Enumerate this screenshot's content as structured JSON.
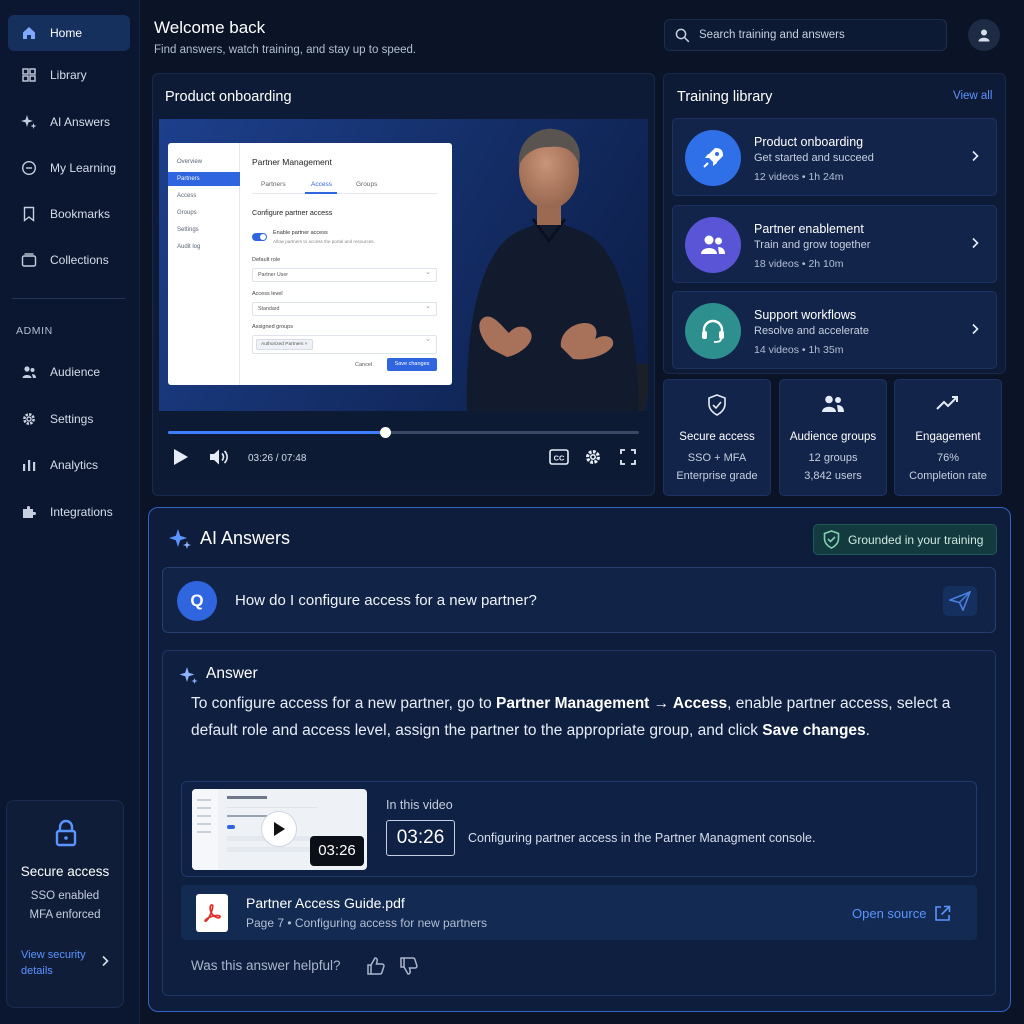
{
  "sidebar": {
    "items": [
      {
        "label": "Home",
        "icon": "home-icon"
      },
      {
        "label": "Library",
        "icon": "library-icon"
      },
      {
        "label": "AI Answers",
        "icon": "sparkle-icon"
      },
      {
        "label": "My Learning",
        "icon": "learning-icon"
      },
      {
        "label": "Bookmarks",
        "icon": "bookmark-icon"
      },
      {
        "label": "Collections",
        "icon": "collections-icon"
      }
    ],
    "admin_heading": "ADMIN",
    "admin_items": [
      {
        "label": "Audience",
        "icon": "audience-icon"
      },
      {
        "label": "Settings",
        "icon": "gear-icon"
      },
      {
        "label": "Analytics",
        "icon": "analytics-icon"
      },
      {
        "label": "Integrations",
        "icon": "puzzle-icon"
      }
    ],
    "secure_card": {
      "title": "Secure access",
      "line1": "SSO enabled",
      "line2": "MFA enforced",
      "link": "View security details"
    }
  },
  "header": {
    "title": "Welcome back",
    "subtitle": "Find answers, watch training, and stay up to speed.",
    "search_placeholder": "Search training and answers"
  },
  "video": {
    "panel_title": "Product onboarding",
    "time": "03:26 / 07:48",
    "progress": 0.46,
    "mock_ui": {
      "nav": [
        "Overview",
        "Partners",
        "Access",
        "Groups",
        "Settings",
        "Audit log"
      ],
      "title": "Partner Management",
      "tabs": [
        "Partners",
        "Access",
        "Groups"
      ],
      "section": "Configure partner access",
      "toggle_label": "Enable partner access",
      "toggle_desc": "Allow partners to access the portal and resources.",
      "default_role_label": "Default role",
      "default_role_value": "Partner User",
      "access_level_label": "Access level",
      "access_level_value": "Standard",
      "groups_label": "Assigned groups",
      "group_chip": "Authorized Partners  ×",
      "cancel": "Cancel",
      "save": "Save changes"
    }
  },
  "library": {
    "title": "Training library",
    "view_all": "View all",
    "courses": [
      {
        "name": "Product onboarding",
        "tagline": "Get started and succeed",
        "meta": "12 videos  •  1h 24m",
        "color": "#2f6fe8",
        "icon": "rocket-icon"
      },
      {
        "name": "Partner enablement",
        "tagline": "Train and grow together",
        "meta": "18 videos  •  2h 10m",
        "color": "#5a55d6",
        "icon": "people-icon"
      },
      {
        "name": "Support workflows",
        "tagline": "Resolve and accelerate",
        "meta": "14 videos  •  1h 35m",
        "color": "#2e8f8f",
        "icon": "headset-icon"
      }
    ],
    "stats": [
      {
        "title": "Secure access",
        "line1": "SSO + MFA",
        "line2": "Enterprise grade",
        "icon": "shield-icon"
      },
      {
        "title": "Audience groups",
        "line1": "12 groups",
        "line2": "3,842 users",
        "icon": "group-icon"
      },
      {
        "title": "Engagement",
        "line1": "76%",
        "line2": "Completion rate",
        "icon": "trend-icon"
      }
    ]
  },
  "ai": {
    "title": "AI Answers",
    "badge": "Grounded in your training",
    "question_badge": "Q",
    "question": "How do I configure access for a new partner?",
    "answer_heading": "Answer",
    "answer": {
      "p1": "To configure access for a new partner, go to ",
      "b1": "Partner Management → Access",
      "p2": ", enable partner access, select a default role and access level, assign the partner to the appropriate group, and click ",
      "b2": "Save changes",
      "p3": "."
    },
    "video_ref": {
      "label": "In this video",
      "timestamp": "03:26",
      "thumb_time": "03:26",
      "description": "Configuring partner access in the Partner Managment console."
    },
    "doc_ref": {
      "name": "Partner Access Guide.pdf",
      "meta": "Page 7  •  Configuring access for new partners",
      "open": "Open source"
    },
    "helpful": "Was this answer helpful?"
  },
  "colors": {
    "accent": "#3f7dff",
    "background": "#0a1426",
    "grounded": "#133a3e"
  }
}
